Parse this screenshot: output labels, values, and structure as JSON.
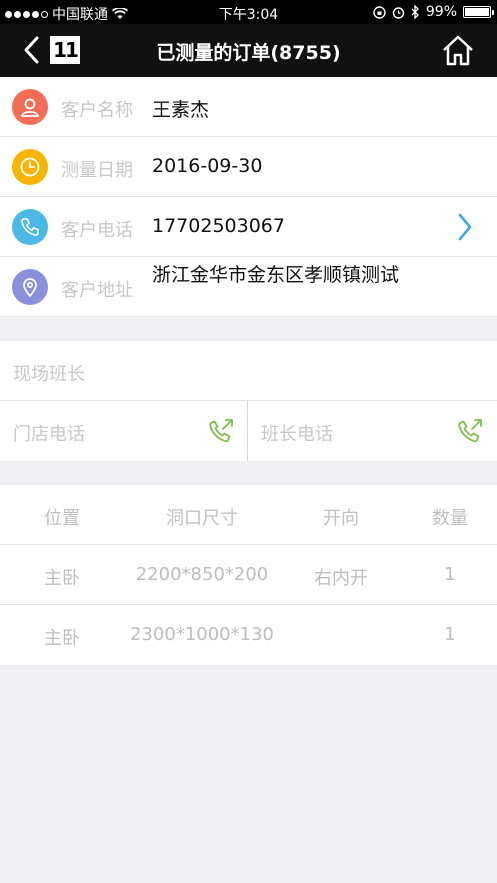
{
  "status_bar": {
    "carrier": "中国联通",
    "time": "下午3:04",
    "battery_percent": "99%",
    "battery_level": 0.99
  },
  "nav": {
    "title": "已测量的订单(8755)",
    "logo_text": "11"
  },
  "customer": {
    "name_label": "客户名称",
    "name_value": "王素杰",
    "date_label": "测量日期",
    "date_value": "2016-09-30",
    "phone_label": "客户电话",
    "phone_value": "17702503067",
    "address_label": "客户地址",
    "address_value": "浙江金华市金东区孝顺镇测试"
  },
  "leader": {
    "title_label": "现场班长",
    "store_phone_label": "门店电话",
    "leader_phone_label": "班长电话"
  },
  "table": {
    "headers": [
      "位置",
      "洞口尺寸",
      "开向",
      "数量"
    ],
    "rows": [
      [
        "主卧",
        "2200*850*200",
        "右内开",
        "1"
      ],
      [
        "主卧",
        "2300*1000*130",
        "",
        "1"
      ]
    ]
  },
  "colors": {
    "user_icon_bg": "#f36d57",
    "date_icon_bg": "#f7b400",
    "phone_icon_bg": "#4cb8e6",
    "address_icon_bg": "#8a90dc",
    "call_icon": "#7cc04b",
    "chevron": "#3fa9e8"
  }
}
